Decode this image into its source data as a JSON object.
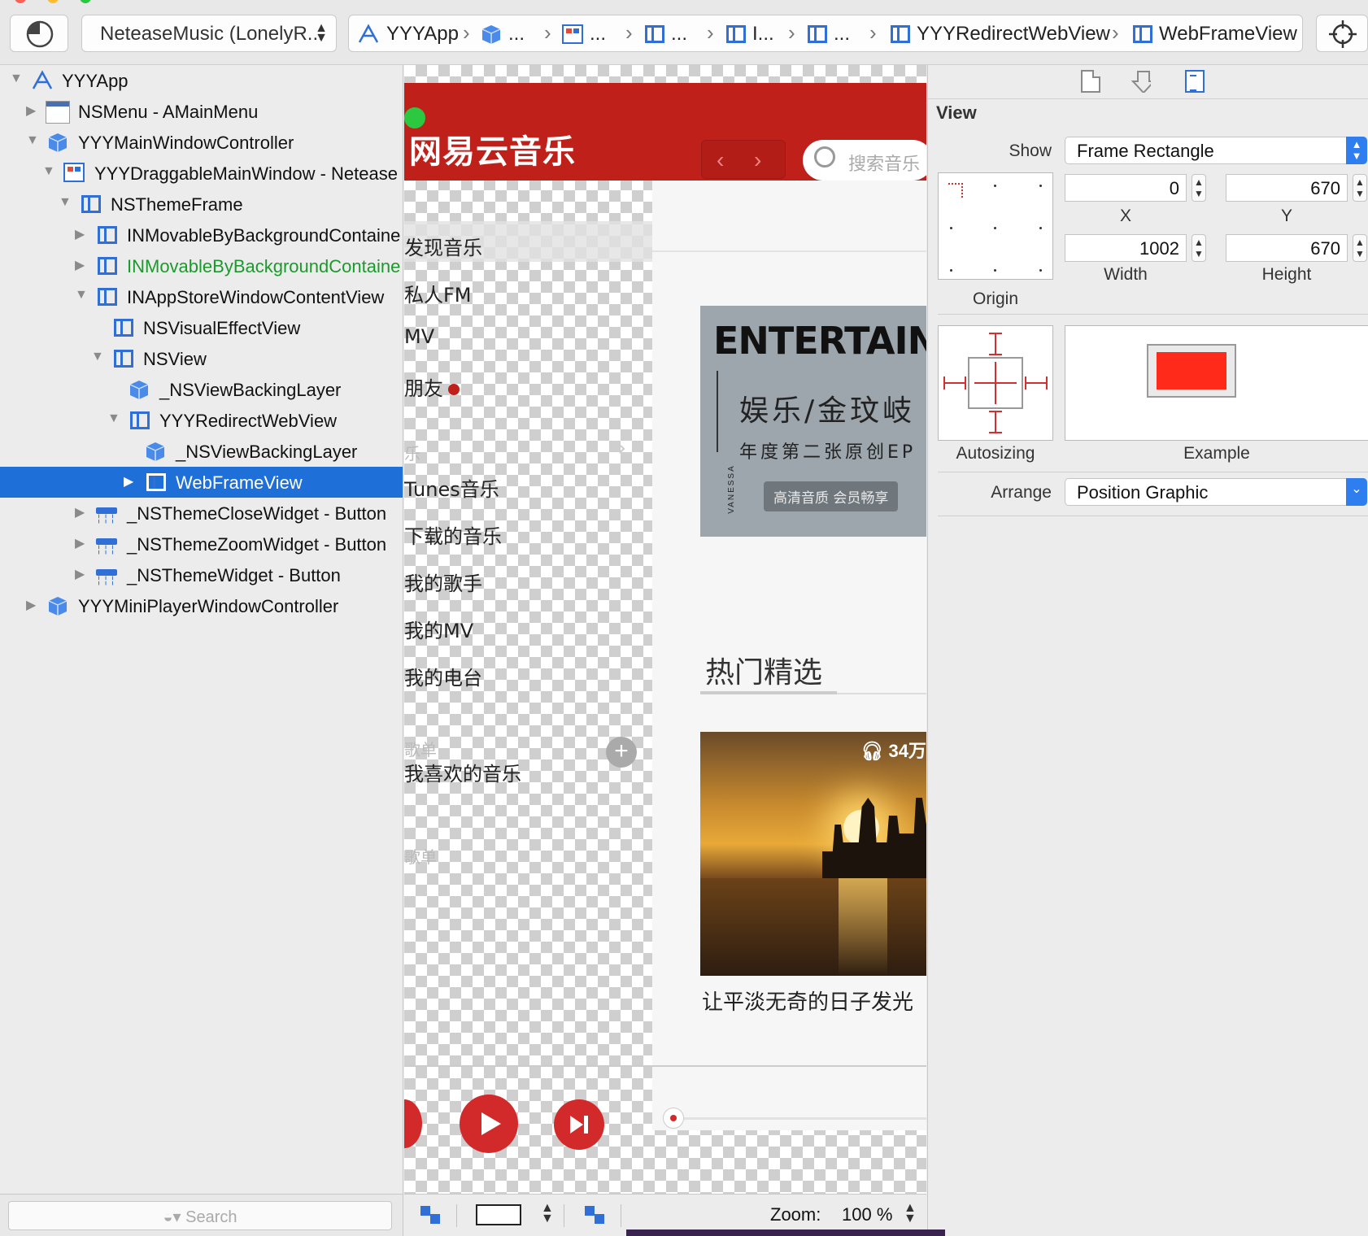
{
  "toolbar": {
    "scheme": "NeteaseMusic (LonelyR...",
    "jump_bar": [
      "YYYApp",
      "...",
      "...",
      "...",
      "I...",
      "...",
      "YYYRedirectWebView",
      "WebFrameView"
    ]
  },
  "outline": {
    "items": [
      {
        "label": "YYYApp",
        "icon": "app-icon"
      },
      {
        "label": "NSMenu - AMainMenu",
        "icon": "menu-icon"
      },
      {
        "label": "YYYMainWindowController",
        "icon": "object-cube-icon"
      },
      {
        "label": "YYYDraggableMainWindow - Netease",
        "icon": "window-icon"
      },
      {
        "label": "NSThemeFrame",
        "icon": "view-icon"
      },
      {
        "label": "INMovableByBackgroundContaine",
        "icon": "view-icon"
      },
      {
        "label": "INMovableByBackgroundContaine",
        "icon": "view-icon",
        "color": "#1b9a2c"
      },
      {
        "label": "INAppStoreWindowContentView",
        "icon": "view-icon"
      },
      {
        "label": "NSVisualEffectView",
        "icon": "view-icon"
      },
      {
        "label": "NSView",
        "icon": "view-icon"
      },
      {
        "label": "_NSViewBackingLayer",
        "icon": "layer-cube-icon"
      },
      {
        "label": "YYYRedirectWebView",
        "icon": "view-icon"
      },
      {
        "label": "_NSViewBackingLayer",
        "icon": "layer-cube-icon"
      },
      {
        "label": "WebFrameView",
        "icon": "view-icon",
        "selected": true
      },
      {
        "label": "_NSThemeCloseWidget - Button",
        "icon": "button-widget-icon"
      },
      {
        "label": "_NSThemeZoomWidget - Button",
        "icon": "button-widget-icon"
      },
      {
        "label": "_NSThemeWidget - Button",
        "icon": "button-widget-icon"
      },
      {
        "label": "YYYMiniPlayerWindowController",
        "icon": "object-cube-icon"
      }
    ],
    "search_placeholder": "Search"
  },
  "canvas": {
    "app_logo": "网易云音乐",
    "search_placeholder": "搜索音乐",
    "sidebar": [
      {
        "label": "发现音乐"
      },
      {
        "label": "私人FM"
      },
      {
        "label": "MV"
      },
      {
        "label": "朋友"
      },
      {
        "label": "乐",
        "muted": true
      },
      {
        "label": "Tunes音乐"
      },
      {
        "label": "下载的音乐"
      },
      {
        "label": "我的歌手"
      },
      {
        "label": "我的MV"
      },
      {
        "label": "我的电台"
      },
      {
        "label": "歌单",
        "muted": true
      },
      {
        "label": "我喜欢的音乐"
      },
      {
        "label": "歌单",
        "muted": true
      }
    ],
    "banner": {
      "headline": "ENTERTAINME",
      "title": "娱乐/金玟岐",
      "subtitle": "年度第二张原创EP",
      "badge": "高清音质 会员畅享",
      "artist_vertical": "VANESSA"
    },
    "section_title": "热门精选",
    "card": {
      "plays": "34万",
      "caption": "让平淡无奇的日子发光"
    },
    "zoom_label": "Zoom:",
    "zoom_value": "100 %"
  },
  "inspector": {
    "section": "View",
    "show_label": "Show",
    "show_value": "Frame Rectangle",
    "x_value": "0",
    "y_value": "670",
    "width_value": "1002",
    "height_value": "670",
    "x_label": "X",
    "y_label": "Y",
    "width_label": "Width",
    "height_label": "Height",
    "origin_label": "Origin",
    "autosizing_label": "Autosizing",
    "example_label": "Example",
    "arrange_label": "Arrange",
    "arrange_value": "Position Graphic",
    "colors": {
      "accent": "#1f6fd8",
      "example_fill": "#ff2a1a",
      "autosize_struts": "#d03030"
    }
  }
}
